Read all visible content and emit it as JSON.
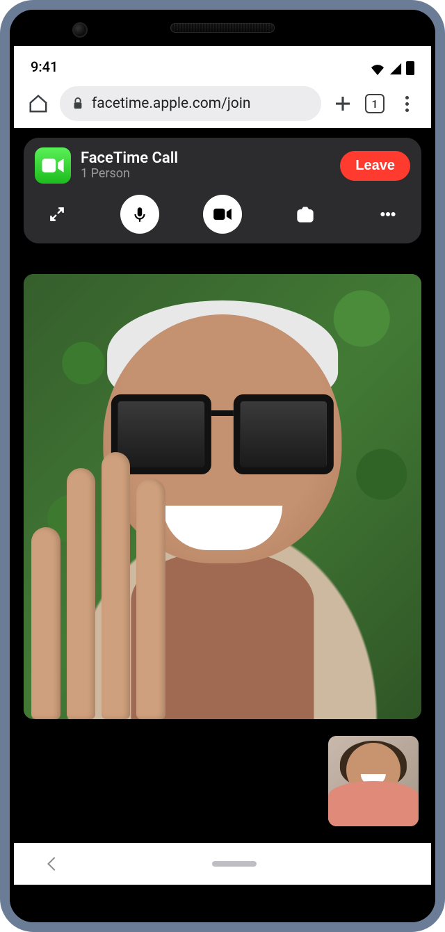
{
  "status_bar": {
    "time": "9:41"
  },
  "browser": {
    "url": "facetime.apple.com/join",
    "tab_count": "1"
  },
  "call": {
    "title": "FaceTime Call",
    "subtitle": "1 Person",
    "leave_label": "Leave"
  },
  "icons": {
    "app": "facetime-app-icon",
    "expand": "expand-icon",
    "mic": "microphone-icon",
    "camera": "video-camera-icon",
    "flip": "flip-camera-icon",
    "more": "more-icon"
  }
}
